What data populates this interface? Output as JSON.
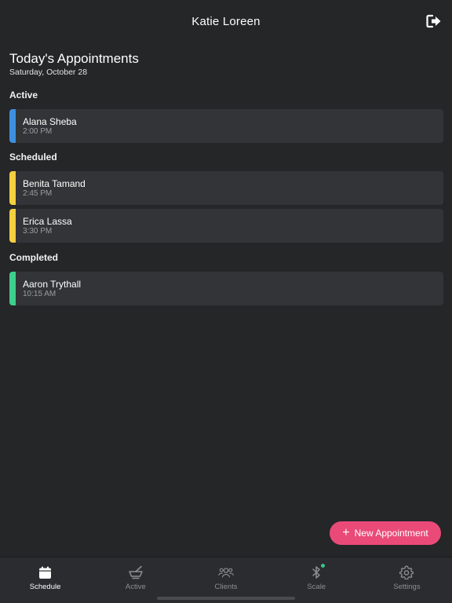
{
  "header": {
    "title": "Katie Loreen",
    "logout_icon": "logout-icon"
  },
  "page": {
    "title": "Today's Appointments",
    "date": "Saturday, October 28"
  },
  "sections": {
    "active": {
      "label": "Active",
      "items": [
        {
          "name": "Alana Sheba",
          "time": "2:00 PM",
          "color": "#3f8fe0"
        }
      ]
    },
    "scheduled": {
      "label": "Scheduled",
      "items": [
        {
          "name": "Benita Tamand",
          "time": "2:45 PM",
          "color": "#f4cf40"
        },
        {
          "name": "Erica Lassa",
          "time": "3:30 PM",
          "color": "#f4cf40"
        }
      ]
    },
    "completed": {
      "label": "Completed",
      "items": [
        {
          "name": "Aaron Trythall",
          "time": "10:15 AM",
          "color": "#3ecf8e"
        }
      ]
    }
  },
  "new_appointment": {
    "label": "New Appointment",
    "icon": "plus-icon",
    "color": "#ea4a78"
  },
  "tabbar": {
    "tabs": [
      {
        "label": "Schedule",
        "icon": "calendar-icon",
        "selected": true
      },
      {
        "label": "Active",
        "icon": "mortar-pestle-icon",
        "selected": false
      },
      {
        "label": "Clients",
        "icon": "users-icon",
        "selected": false
      },
      {
        "label": "Scale",
        "icon": "bluetooth-icon",
        "selected": false,
        "status_color": "#39c78a"
      },
      {
        "label": "Settings",
        "icon": "gear-icon",
        "selected": false
      }
    ]
  }
}
